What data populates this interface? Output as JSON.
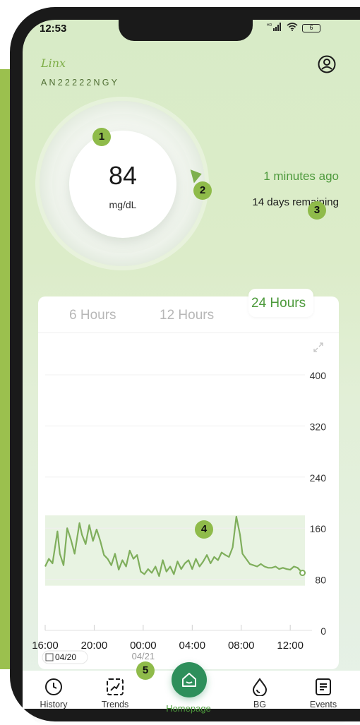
{
  "status_bar": {
    "time": "12:53",
    "signal_badge": "HD",
    "battery": "6"
  },
  "header": {
    "logo": "Linx",
    "device_id": "AN22222NGY"
  },
  "reading": {
    "value": "84",
    "unit": "mg/dL",
    "updated": "1 minutes ago",
    "remaining": "14 days remaining"
  },
  "badges": [
    "1",
    "2",
    "3",
    "4",
    "5"
  ],
  "tabs": [
    {
      "label": "6 Hours",
      "active": false
    },
    {
      "label": "12 Hours",
      "active": false
    },
    {
      "label": "24 Hours",
      "active": true
    }
  ],
  "nav": {
    "history": "History",
    "trends": "Trends",
    "homepage": "Homepage",
    "bg": "BG",
    "events": "Events"
  },
  "colors": {
    "accent": "#4d9a3c",
    "badge": "#8fbb4a",
    "home": "#2e8f5b",
    "line": "#7fae5c",
    "target_band": "#e8f3e2"
  },
  "chart_data": {
    "type": "line",
    "y_ticks": [
      "400",
      "320",
      "240",
      "160",
      "80",
      "0"
    ],
    "y_values": [
      400,
      320,
      240,
      160,
      80,
      0
    ],
    "ylim": [
      0,
      400
    ],
    "target_range": [
      70,
      180
    ],
    "x_tick_labels": [
      "16:00",
      "20:00",
      "00:00",
      "04:00",
      "08:00",
      "12:00"
    ],
    "x_ticks_hours": [
      16,
      20,
      24,
      28,
      32,
      36
    ],
    "xlim_hours": [
      16,
      37.2
    ],
    "date_start": "04/20",
    "date_next": "04/21",
    "series": [
      {
        "x": [
          16.0,
          16.3,
          16.6,
          17.0,
          17.2,
          17.5,
          17.8,
          18.1,
          18.4,
          18.8,
          19.0,
          19.3,
          19.6,
          19.9,
          20.2,
          20.5,
          20.8,
          21.1,
          21.4,
          21.7,
          22.0,
          22.3,
          22.6,
          22.9,
          23.2,
          23.5,
          23.8,
          24.1,
          24.4,
          24.7,
          25.0,
          25.3,
          25.6,
          25.9,
          26.2,
          26.5,
          26.8,
          27.1,
          27.4,
          27.7,
          28.0,
          28.3,
          28.6,
          28.9,
          29.2,
          29.5,
          29.8,
          30.1,
          30.4,
          30.7,
          31.0,
          31.3,
          31.6,
          31.9,
          32.1,
          32.4,
          32.7,
          33.0,
          33.3,
          33.6,
          33.9,
          34.2,
          34.5,
          34.8,
          35.1,
          35.4,
          35.7,
          36.0,
          36.3,
          36.6,
          36.9,
          37.0
        ],
        "y": [
          100,
          112,
          105,
          155,
          120,
          102,
          160,
          142,
          120,
          168,
          150,
          135,
          165,
          140,
          158,
          140,
          118,
          112,
          102,
          120,
          95,
          110,
          100,
          125,
          112,
          118,
          92,
          88,
          96,
          90,
          100,
          85,
          110,
          92,
          100,
          88,
          108,
          96,
          105,
          110,
          96,
          112,
          100,
          108,
          118,
          105,
          115,
          110,
          122,
          118,
          115,
          130,
          178,
          150,
          120,
          112,
          104,
          102,
          100,
          104,
          100,
          98,
          98,
          100,
          96,
          98,
          96,
          95,
          100,
          98,
          92,
          90
        ]
      }
    ]
  }
}
